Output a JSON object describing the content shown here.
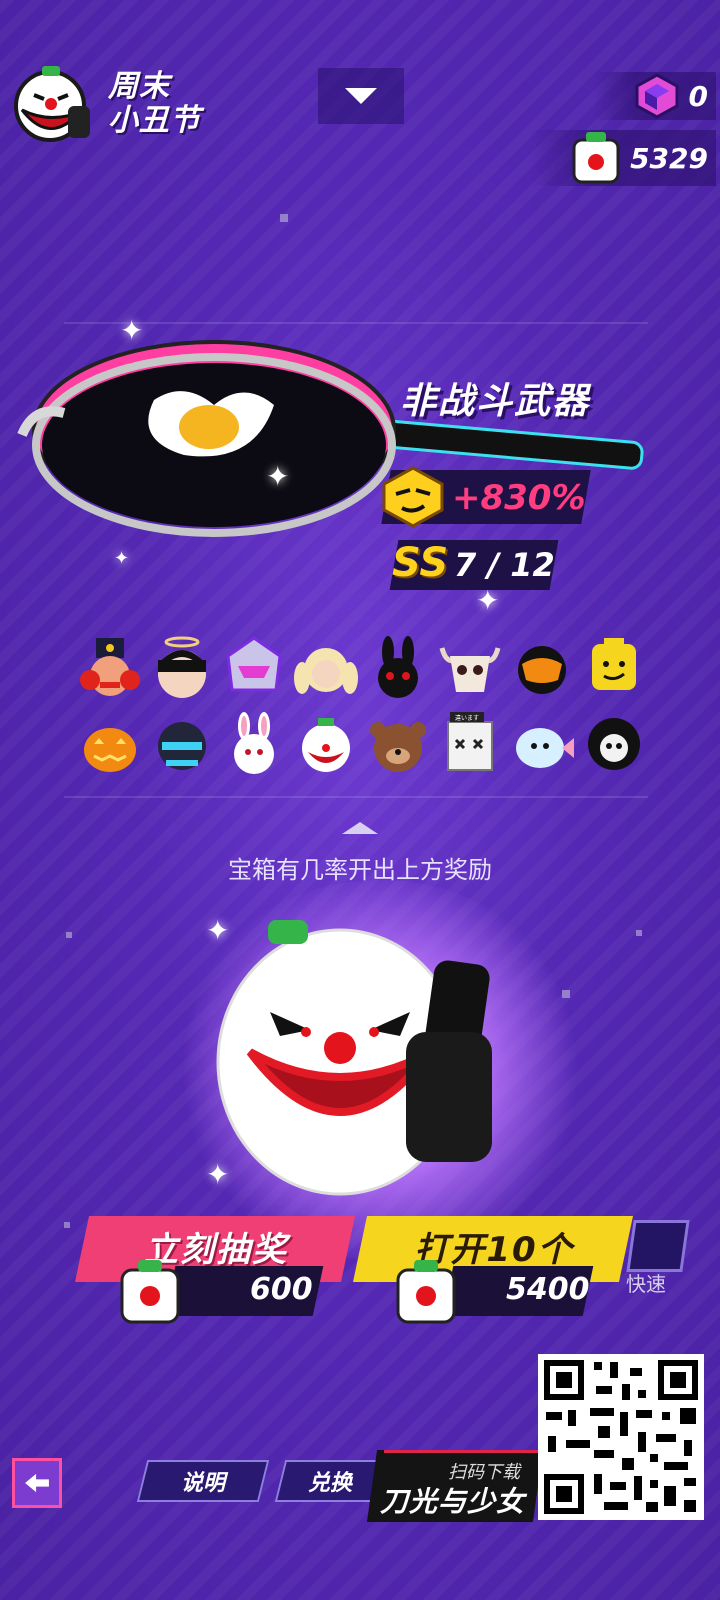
{
  "header": {
    "event_title_line1": "周末",
    "event_title_line2": "小丑节",
    "logo_icon": "clown-mask-icon",
    "dropdown_icon": "chevron-down-icon"
  },
  "currencies": [
    {
      "icon": "purple-gem-icon",
      "value": "0"
    },
    {
      "icon": "clown-token-icon",
      "value": "5329"
    }
  ],
  "featured": {
    "item_icon": "frying-pan-icon",
    "type_label": "非战斗武器",
    "boost_icon": "yellow-face-icon",
    "boost_value": "+830%",
    "rank_tier": "SS",
    "rank_count": "7 / 12"
  },
  "rewards": [
    {
      "name": "nutcracker-mask-icon"
    },
    {
      "name": "halo-hair-icon"
    },
    {
      "name": "mecha-helmet-icon"
    },
    {
      "name": "blonde-pigtails-icon"
    },
    {
      "name": "black-rabbit-mask-icon"
    },
    {
      "name": "horned-skull-mask-icon"
    },
    {
      "name": "visor-helmet-icon"
    },
    {
      "name": "block-figure-head-icon"
    },
    {
      "name": "pumpkin-head-icon"
    },
    {
      "name": "knight-helmet-icon"
    },
    {
      "name": "bunny-head-icon"
    },
    {
      "name": "clown-head-icon"
    },
    {
      "name": "bear-head-icon"
    },
    {
      "name": "box-head-icon"
    },
    {
      "name": "fish-head-icon"
    },
    {
      "name": "skull-hood-icon"
    }
  ],
  "box_label": "違います",
  "note": "宝箱有几率开出上方奖励",
  "draw_once": {
    "label": "立刻抽奖",
    "cost": "600",
    "icon": "clown-token-icon"
  },
  "draw_ten": {
    "label": "打开10个",
    "cost": "5400",
    "icon": "clown-token-icon"
  },
  "quick_label": "快速",
  "footer": {
    "back_icon": "back-arrow-icon",
    "tab_info": "说明",
    "tab_exchange": "兑换",
    "promo_sub": "扫码下载",
    "promo_main": "刀光与少女",
    "qr_icon": "qr-code-icon"
  },
  "colors": {
    "bg": "#5428b3",
    "pink_button": "#ef3f74",
    "yellow_button": "#f5d51d",
    "boost_text": "#ff3d7f",
    "rank_text": "#ffd21e"
  }
}
